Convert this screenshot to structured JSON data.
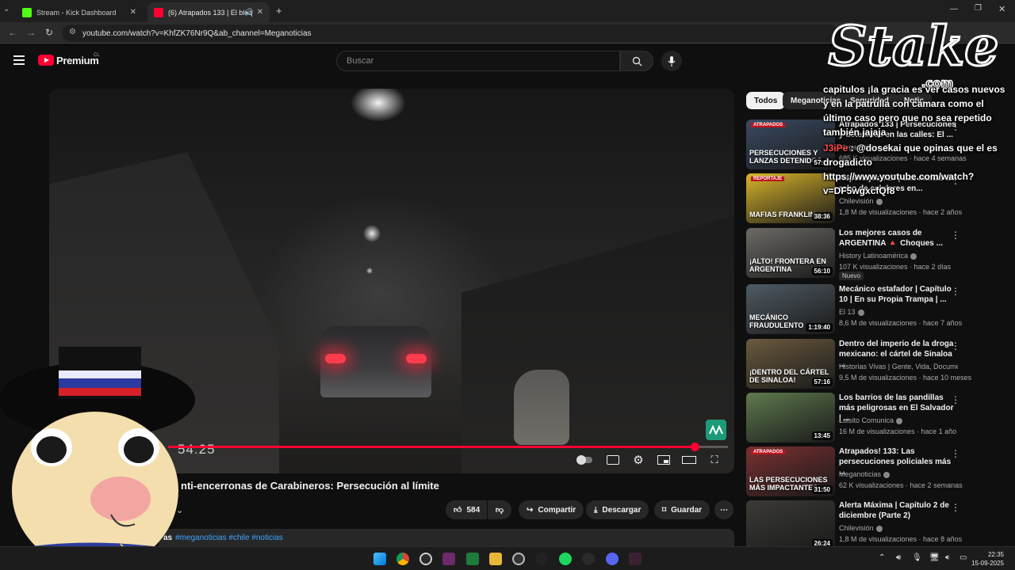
{
  "browser": {
    "tabs": [
      {
        "title": "Stream - Kick Dashboard",
        "active": false
      },
      {
        "title": "(6) Atrapados 133 | El bloq",
        "active": true
      }
    ],
    "url": "youtube.com/watch?v=KhfZK76Nr9Q&ab_channel=Meganoticias"
  },
  "masthead": {
    "logo_text": "Premium",
    "country_code": "CL",
    "search_placeholder": "Buscar"
  },
  "player": {
    "current_time": "54:25",
    "progress_fraction": 0.94
  },
  "video": {
    "title": "nti-encerronas de Carabineros: Persecución al límite",
    "likes": "584",
    "share_label": "Compartir",
    "download_label": "Descargar",
    "save_label": "Guardar",
    "desc_prefix": "as",
    "hashtags": "#meganoticias #chile #noticias"
  },
  "filters": [
    "Todos",
    "Meganoticias",
    "Seguridad",
    "Notic"
  ],
  "recommendations": [
    {
      "thumb_text": "PERSECUCIONES Y LANZAS DETENIDOS",
      "thumb_color": "#3a4a63",
      "badge_top": "ATRAPADOS",
      "duration": "57:13",
      "title": "Atrapados 133 | Persecuciones y detenidos en las calles: El ...",
      "channel": "Meganoticias",
      "meta": "685 K visualizaciones · hace 4 semanas"
    },
    {
      "thumb_text": "MAFIAS FRANKLIN",
      "thumb_color": "#d9b52a",
      "badge_top": "REPORTAJE",
      "duration": "38:36",
      "title": "Reportajes T13 | Las mafias de robo de celulares en...",
      "channel": "Chilevisión",
      "meta": "1,8 M de visualizaciones · hace 2 años"
    },
    {
      "thumb_text": "¡ALTO! FRONTERA EN ARGENTINA",
      "thumb_color": "#6d6a66",
      "badge_top": "",
      "duration": "56:10",
      "title": "Los mejores casos de ARGENTINA 🔺 Choques ...",
      "channel": "History Latinoamérica",
      "meta": "107 K visualizaciones · hace 2 días",
      "badge": "Nuevo"
    },
    {
      "thumb_text": "MECÁNICO FRAUDULENTO",
      "thumb_color": "#4f5a63",
      "badge_top": "",
      "duration": "1:19:40",
      "title": "Mecánico estafador | Capítulo 10 | En su Propia Trampa | ...",
      "channel": "El 13",
      "meta": "8,6 M de visualizaciones · hace 7 años"
    },
    {
      "thumb_text": "¡DENTRO DEL CÁRTEL DE SINALOA!",
      "thumb_color": "#6b5a3e",
      "badge_top": "",
      "duration": "57:16",
      "title": "Dentro del imperio de la droga mexicano: el cártel de Sinaloa ...",
      "channel": "Historias Vivas | Gente, Vida, Documenta...",
      "meta": "9,5 M de visualizaciones · hace 10 meses"
    },
    {
      "thumb_text": "",
      "thumb_color": "#5e7a4e",
      "badge_top": "",
      "duration": "13:45",
      "title": "Los barrios de las pandillas más peligrosas en El Salvador | ...",
      "channel": "Luisito Comunica",
      "meta": "16 M de visualizaciones · hace 1 año"
    },
    {
      "thumb_text": "LAS PERSECUCIONES MÁS IMPACTANTES",
      "thumb_color": "#7a3030",
      "badge_top": "ATRAPADOS",
      "duration": "31:50",
      "title": "Atrapados! 133: Las persecuciones policiales más ...",
      "channel": "Meganoticias",
      "meta": "62 K visualizaciones · hace 2 semanas"
    },
    {
      "thumb_text": "",
      "thumb_color": "#3b3a36",
      "badge_top": "",
      "duration": "26:24",
      "title": "Alerta Máxima | Capítulo 2 de diciembre (Parte 2)",
      "channel": "Chilevisión",
      "meta": "1,8 M de visualizaciones · hace 8 años"
    }
  ],
  "overlay": {
    "stake_logo": "Stake",
    "stake_sub": ".com",
    "chat": [
      {
        "user": "",
        "text": "capitulos ¡la gracia es ver casos nuevos y en la patrulla con camara como el último caso pero que no sea repetido también jajaja"
      },
      {
        "user": "J3iPe",
        "text": " : @dosekai que opinas que el es drogadicto https://www.youtube.com/watch?v=DF5wgxcfQf8"
      }
    ]
  },
  "taskbar": {
    "time": "22:35",
    "date": "15-09-2025"
  },
  "colors": {
    "accent_red": "#ff0033",
    "bg": "#0f0f0f",
    "surface": "#272727"
  }
}
